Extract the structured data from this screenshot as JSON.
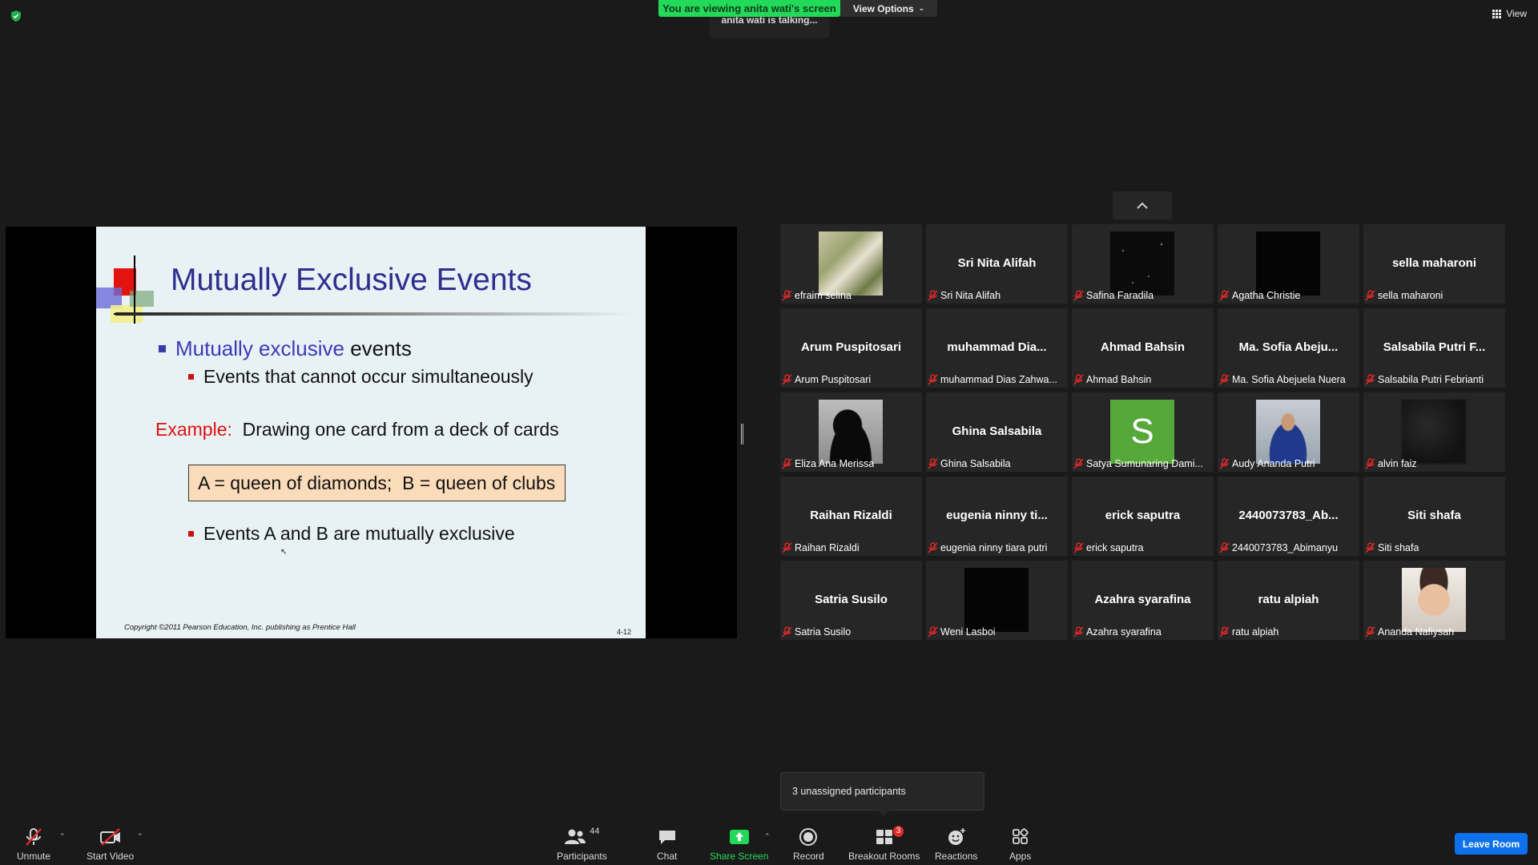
{
  "top": {
    "viewing_banner": "You are viewing anita wati's screen",
    "view_options": "View Options",
    "talking": "anita wati is talking...",
    "view_button": "View"
  },
  "slide": {
    "title": "Mutually Exclusive Events",
    "bullet1_highlight": "Mutually exclusive",
    "bullet1_rest": "events",
    "bullet2": "Events that cannot occur simultaneously",
    "example_label": "Example:",
    "example_text": "Drawing one card from a deck of cards",
    "definition_box": "A = queen of diamonds;  B = queen of clubs",
    "bullet3": "Events A and B are mutually exclusive",
    "copyright": "Copyright ©2011 Pearson Education, Inc. publishing as Prentice Hall",
    "page_number": "4-12"
  },
  "gallery": {
    "tiles": [
      {
        "name": "efraim selina",
        "big": "",
        "thumb": "photo-indoor"
      },
      {
        "name": "Sri Nita Alifah",
        "big": "Sri Nita Alifah",
        "thumb": ""
      },
      {
        "name": "Safina Faradila",
        "big": "",
        "thumb": "dark-stars"
      },
      {
        "name": "Agatha Christie",
        "big": "",
        "thumb": "black"
      },
      {
        "name": "sella maharoni",
        "big": "sella maharoni",
        "thumb": ""
      },
      {
        "name": "Arum Puspitosari",
        "big": "Arum Puspitosari",
        "thumb": ""
      },
      {
        "name": "muhammad Dias Zahwa...",
        "big": "muhammad  Dia...",
        "thumb": ""
      },
      {
        "name": "Ahmad Bahsin",
        "big": "Ahmad Bahsin",
        "thumb": ""
      },
      {
        "name": "Ma. Sofia Abejuela Nuera",
        "big": "Ma. Sofia  Abeju...",
        "thumb": ""
      },
      {
        "name": "Salsabila Putri Febrianti",
        "big": "Salsabila  Putri  F...",
        "thumb": ""
      },
      {
        "name": "Eliza Ana Merissa",
        "big": "",
        "thumb": "silhouette"
      },
      {
        "name": "Ghina Salsabila",
        "big": "Ghina Salsabila",
        "thumb": ""
      },
      {
        "name": "Satya Sumunaring Dami...",
        "big": "",
        "thumb": "letter-s"
      },
      {
        "name": "Audy Ananda Putri",
        "big": "",
        "thumb": "photo-person"
      },
      {
        "name": "alvin faiz",
        "big": "",
        "thumb": "blur-dark"
      },
      {
        "name": "Raihan Rizaldi",
        "big": "Raihan Rizaldi",
        "thumb": ""
      },
      {
        "name": "eugenia ninny tiara putri",
        "big": "eugenia  ninny  ti...",
        "thumb": ""
      },
      {
        "name": "erick saputra",
        "big": "erick saputra",
        "thumb": ""
      },
      {
        "name": "2440073783_Abimanyu",
        "big": "2440073783_Ab...",
        "thumb": ""
      },
      {
        "name": "Siti shafa",
        "big": "Siti shafa",
        "thumb": ""
      },
      {
        "name": "Satria Susilo",
        "big": "Satria Susilo",
        "thumb": ""
      },
      {
        "name": "Weni Lasboi",
        "big": "",
        "thumb": "black"
      },
      {
        "name": "Azahra syarafina",
        "big": "Azahra syarafina",
        "thumb": ""
      },
      {
        "name": "ratu alpiah",
        "big": "ratu alpiah",
        "thumb": ""
      },
      {
        "name": "Ananda Nafiysah",
        "big": "",
        "thumb": "photo-baby"
      }
    ],
    "avatar_letter": "S",
    "avatar_color": "#56a83a"
  },
  "notice": "3 unassigned participants",
  "toolbar": {
    "unmute": "Unmute",
    "start_video": "Start Video",
    "participants": "Participants",
    "participants_count": "44",
    "chat": "Chat",
    "share_screen": "Share Screen",
    "record": "Record",
    "breakout_rooms": "Breakout Rooms",
    "breakout_badge": "3",
    "reactions": "Reactions",
    "apps": "Apps",
    "leave": "Leave Room"
  },
  "colors": {
    "banner_green": "#23d959",
    "share_green": "#23d959",
    "leave_blue": "#0e71eb",
    "muted_red": "#e02828"
  }
}
